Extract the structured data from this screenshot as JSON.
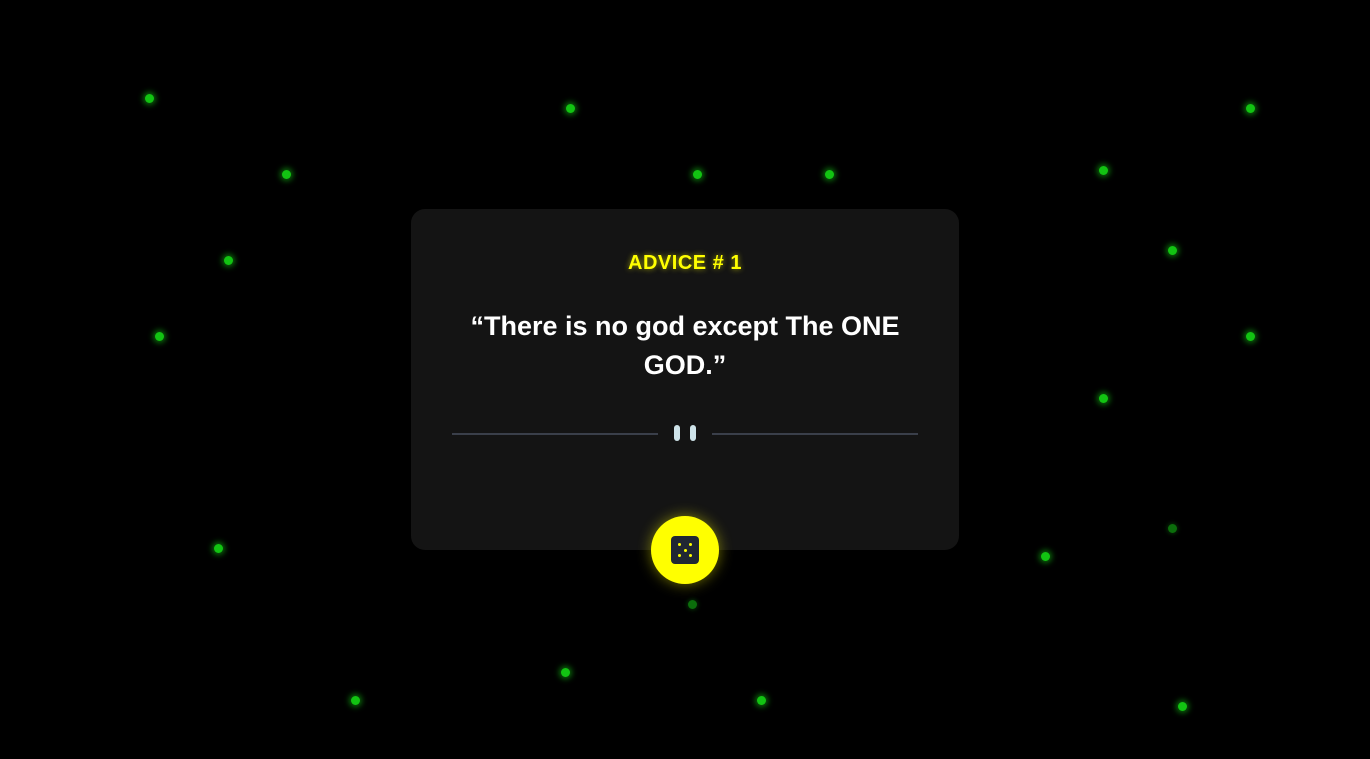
{
  "advice": {
    "id_label": "ADVICE # 1",
    "text": "“There is no god except The ONE GOD.”"
  },
  "icons": {
    "divider": "pause-icon",
    "button": "dice-icon"
  },
  "colors": {
    "background": "#000000",
    "card": "#141414",
    "accent": "#ffff00",
    "particles": "#12c312",
    "divider": "#3a3f4a"
  }
}
